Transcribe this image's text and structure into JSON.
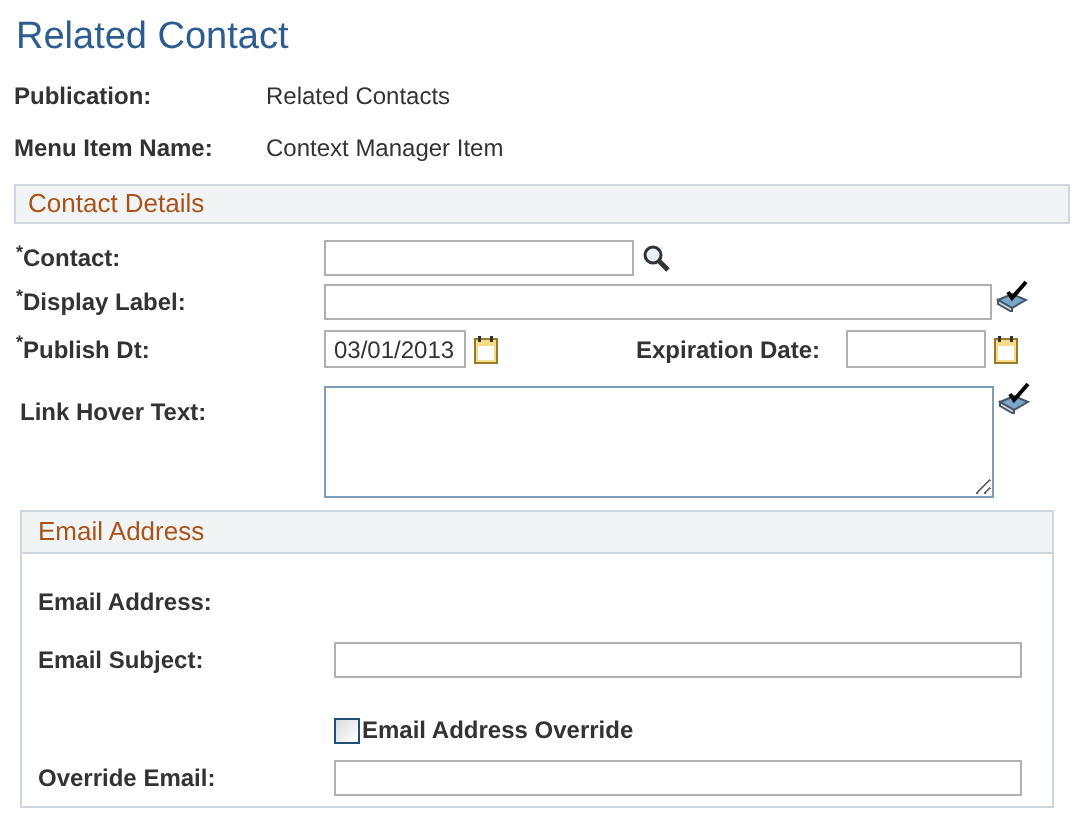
{
  "title": "Related Contact",
  "info": [
    {
      "label": "Publication:",
      "value": "Related Contacts"
    },
    {
      "label": "Menu Item Name:",
      "value": "Context Manager Item"
    }
  ],
  "contact_details": {
    "heading": "Contact Details",
    "contact": {
      "label": "$^{*}$Contact:"
    },
    "display_label": {
      "label": "$^{*}$Display Label:"
    },
    "publish_dt": {
      "label": "$^{*}$Publish Dt:",
      "value": "03/01/2013"
    },
    "expiration_date": {
      "label": "Expiration Date:"
    },
    "link_hover_text": {
      "label": "Link Hover Text:"
    }
  },
  "email": {
    "heading": "Email Address",
    "address_label": "Email Address:",
    "subject": {
      "label": "Email Subject:"
    },
    "override": {
      "label": "Email Address Override",
      "checked": false
    },
    "override_email": {
      "label": "Override Email:"
    }
  }
}
